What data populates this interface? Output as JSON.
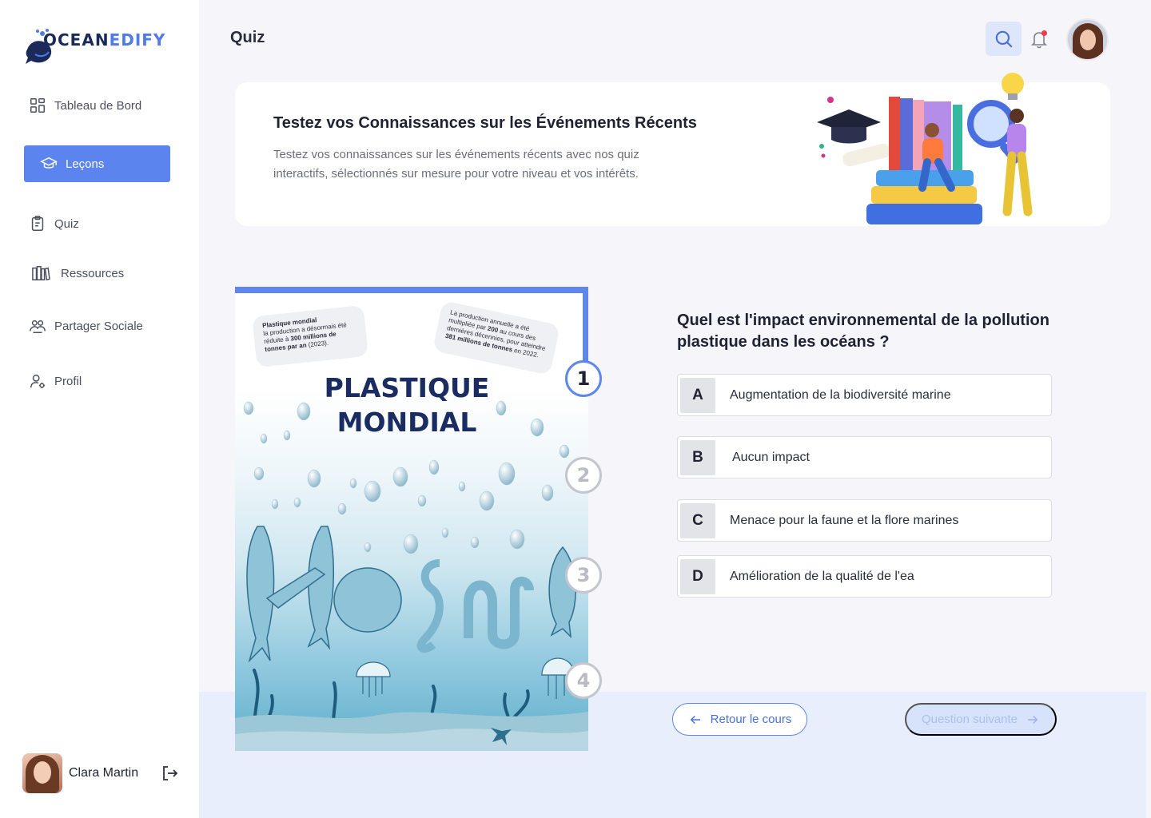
{
  "brand": {
    "logo_text_a": "OCEAN",
    "logo_text_b": "EDIFY"
  },
  "sidebar": {
    "items": [
      {
        "label": "Tableau de Bord",
        "icon": "dashboard-icon"
      },
      {
        "label": "Leçons",
        "icon": "graduation-cap-icon",
        "active": true
      },
      {
        "label": "Quiz",
        "icon": "clipboard-icon"
      },
      {
        "label": "Ressources",
        "icon": "library-icon"
      },
      {
        "label": "Partager Sociale",
        "icon": "community-icon"
      },
      {
        "label": "Profil",
        "icon": "user-settings-icon"
      }
    ],
    "user": {
      "name": "Clara Martin"
    }
  },
  "header": {
    "title": "Quiz",
    "notification_dot_color": "#ef3a4c"
  },
  "banner": {
    "title": "Testez vos Connaissances sur les Événements Récents",
    "description": "Testez vos connaissances sur les événements récents avec nos quiz interactifs, sélectionnés sur mesure pour votre niveau et vos intérêts."
  },
  "infographic": {
    "title_line1": "PLASTIQUE",
    "title_line2": "MONDIAL",
    "bottle1": {
      "head": "Plastique mondial",
      "text_a": "la production a désormais été réduite à ",
      "bold": "300 millions de tonnes par an",
      "text_b": " (2023)."
    },
    "bottle2": {
      "text_a": "La production annuelle a été multipliée par ",
      "bold_a": "200",
      "text_b": " au cours des dernières décennies, pour atteindre ",
      "bold_b": "381 millions de tonnes",
      "text_c": " en 2022."
    },
    "steps": [
      {
        "label": "1",
        "state": "done"
      },
      {
        "label": "2",
        "state": "todo"
      },
      {
        "label": "3",
        "state": "todo"
      },
      {
        "label": "4",
        "state": "todo"
      }
    ]
  },
  "quiz": {
    "question": "Quel est l'impact environnemental de la pollution plastique dans les océans ?",
    "options": [
      {
        "letter": "A",
        "text": "Augmentation de la biodiversité marine"
      },
      {
        "letter": "B",
        "text": "Aucun impact"
      },
      {
        "letter": "C",
        "text": "Menace pour la faune et la flore marines"
      },
      {
        "letter": "D",
        "text": "Amélioration de la qualité de l'ea"
      }
    ]
  },
  "footer": {
    "back_label": "Retour le cours",
    "next_label": "Question suivante"
  },
  "colors": {
    "accent": "#5b84ee",
    "accent_light": "#d7e2fb",
    "navy": "#1a2c62"
  }
}
